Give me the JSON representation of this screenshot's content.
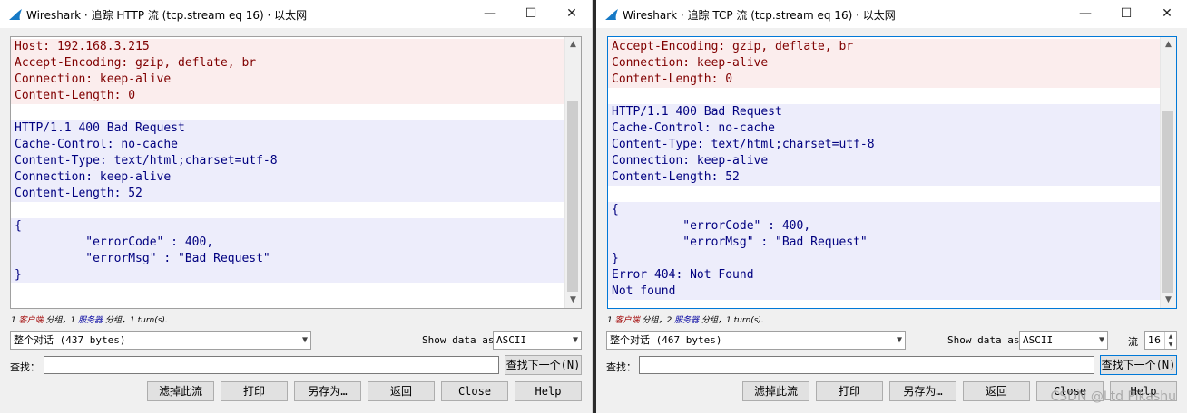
{
  "left": {
    "title": "Wireshark · 追踪 HTTP 流 (tcp.stream eq 16) · 以太网",
    "controls": {
      "minimize": "—",
      "maximize": "☐",
      "close": "✕"
    },
    "lines": [
      {
        "t": "Host: 192.168.3.215",
        "k": "c"
      },
      {
        "t": "Accept-Encoding: gzip, deflate, br",
        "k": "c"
      },
      {
        "t": "Connection: keep-alive",
        "k": "c"
      },
      {
        "t": "Content-Length: 0",
        "k": "c"
      },
      {
        "t": "",
        "k": "blank"
      },
      {
        "t": "HTTP/1.1 400 Bad Request",
        "k": "s"
      },
      {
        "t": "Cache-Control: no-cache",
        "k": "s"
      },
      {
        "t": "Content-Type: text/html;charset=utf-8",
        "k": "s"
      },
      {
        "t": "Connection: keep-alive",
        "k": "s"
      },
      {
        "t": "Content-Length: 52",
        "k": "s"
      },
      {
        "t": "",
        "k": "blank"
      },
      {
        "t": "{",
        "k": "s"
      },
      {
        "t": "          \"errorCode\" : 400,",
        "k": "s"
      },
      {
        "t": "          \"errorMsg\" : \"Bad Request\"",
        "k": "s"
      },
      {
        "t": "}",
        "k": "s"
      }
    ],
    "stats": {
      "c_count": "1",
      "c_label": "客户端",
      "mid": "分组，1",
      "s_label": "服务器",
      "end": "分组，1 turn(s)."
    },
    "conversation": "整个对话 (437 bytes)",
    "show_data_as_label": "Show data as",
    "show_data_as_value": "ASCII",
    "find_label": "查找：",
    "find_next": "查找下一个(N)",
    "buttons": [
      "滤掉此流",
      "打印",
      "另存为…",
      "返回",
      "Close",
      "Help"
    ]
  },
  "right": {
    "title": "Wireshark · 追踪 TCP 流 (tcp.stream eq 16) · 以太网",
    "controls": {
      "minimize": "—",
      "maximize": "☐",
      "close": "✕"
    },
    "lines": [
      {
        "t": "Accept-Encoding: gzip, deflate, br",
        "k": "c"
      },
      {
        "t": "Connection: keep-alive",
        "k": "c"
      },
      {
        "t": "Content-Length: 0",
        "k": "c"
      },
      {
        "t": "",
        "k": "blank"
      },
      {
        "t": "HTTP/1.1 400 Bad Request",
        "k": "s"
      },
      {
        "t": "Cache-Control: no-cache",
        "k": "s"
      },
      {
        "t": "Content-Type: text/html;charset=utf-8",
        "k": "s"
      },
      {
        "t": "Connection: keep-alive",
        "k": "s"
      },
      {
        "t": "Content-Length: 52",
        "k": "s"
      },
      {
        "t": "",
        "k": "blank"
      },
      {
        "t": "{",
        "k": "s"
      },
      {
        "t": "          \"errorCode\" : 400,",
        "k": "s"
      },
      {
        "t": "          \"errorMsg\" : \"Bad Request\"",
        "k": "s"
      },
      {
        "t": "}",
        "k": "s"
      },
      {
        "t": "Error 404: Not Found",
        "k": "s"
      },
      {
        "t": "Not found",
        "k": "s"
      }
    ],
    "stats": {
      "c_count": "1",
      "c_label": "客户端",
      "mid": "分组，2",
      "s_label": "服务器",
      "end": "分组，1 turn(s)."
    },
    "conversation": "整个对话 (467 bytes)",
    "show_data_as_label": "Show data as",
    "show_data_as_value": "ASCII",
    "stream_label": "流",
    "stream_value": "16",
    "find_label": "查找：",
    "find_next": "查找下一个(N)",
    "buttons": [
      "滤掉此流",
      "打印",
      "另存为…",
      "返回",
      "Close",
      "Help"
    ]
  },
  "watermark": "CSDN @Ltd Pikashu",
  "colors": {
    "client_text": "#800000",
    "client_bg": "#fbeded",
    "server_text": "#000080",
    "server_bg": "#ededfb",
    "focus_border": "#0078d7"
  }
}
